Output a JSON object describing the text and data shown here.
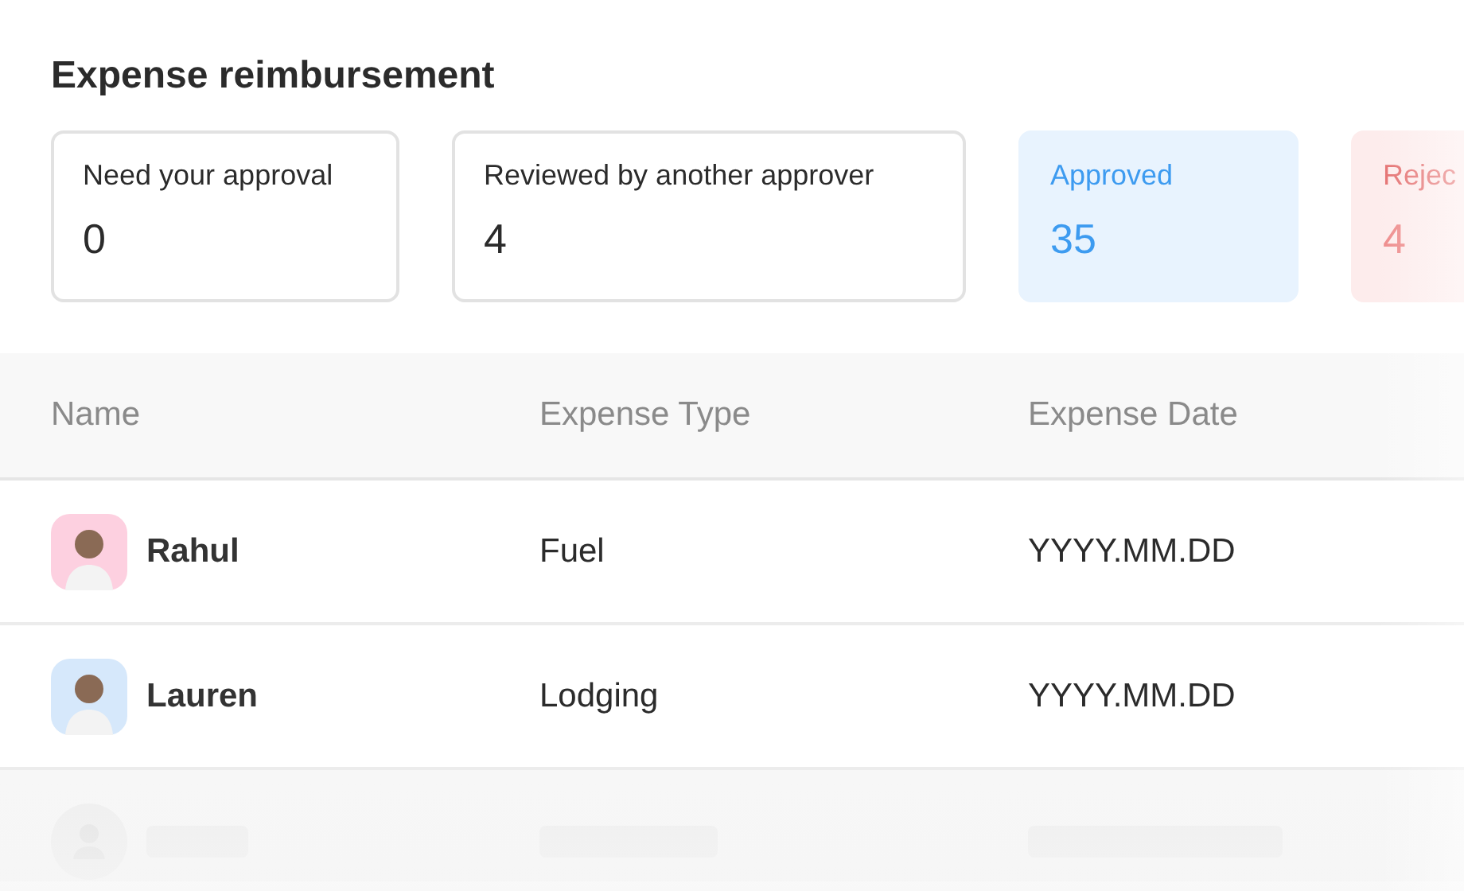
{
  "title": "Expense reimbursement",
  "stats": [
    {
      "kind": "neutral",
      "label": "Need your approval",
      "value": "0"
    },
    {
      "kind": "neutral",
      "label": "Reviewed by another approver",
      "value": "4"
    },
    {
      "kind": "info",
      "label": "Approved",
      "value": "35"
    },
    {
      "kind": "danger",
      "label": "Rejec",
      "value": "4"
    }
  ],
  "table": {
    "columns": [
      "Name",
      "Expense Type",
      "Expense Date"
    ],
    "rows": [
      {
        "name": "Rahul",
        "color": "#fdd0e0",
        "type": "Fuel",
        "date": "YYYY.MM.DD"
      },
      {
        "name": "Lauren",
        "color": "#d6e8fb",
        "type": "Lodging",
        "date": "YYYY.MM.DD"
      }
    ]
  }
}
